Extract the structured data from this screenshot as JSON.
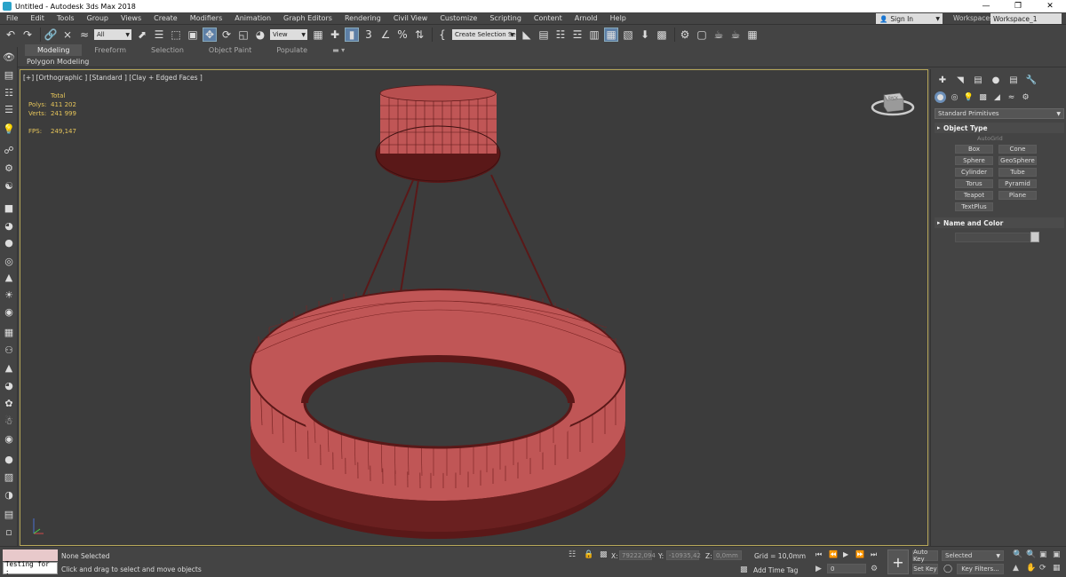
{
  "window": {
    "title": "Untitled - Autodesk 3ds Max 2018",
    "controls": [
      "—",
      "❐",
      "✕"
    ]
  },
  "menubar": {
    "items": [
      "File",
      "Edit",
      "Tools",
      "Group",
      "Views",
      "Create",
      "Modifiers",
      "Animation",
      "Graph Editors",
      "Rendering",
      "Civil View",
      "Customize",
      "Scripting",
      "Content",
      "Arnold",
      "Help"
    ],
    "signin_label": "Sign In",
    "workspaces_label": "Workspaces:",
    "workspace_value": "Workspace_1"
  },
  "toolbar": {
    "filter_value": "All",
    "refcoord_value": "View",
    "selection_set_value": "Create Selection Se"
  },
  "ribbon": {
    "tabs": [
      "Modeling",
      "Freeform",
      "Selection",
      "Object Paint",
      "Populate"
    ],
    "active_tab": "Modeling",
    "panel_label": "Polygon Modeling"
  },
  "viewport": {
    "label": "[+] [Orthographic ] [Standard ] [Clay + Edged Faces ]",
    "stats": {
      "total_label": "Total",
      "polys_label": "Polys:",
      "polys_value": "411 202",
      "verts_label": "Verts:",
      "verts_value": "241 999",
      "fps_label": "FPS:",
      "fps_value": "249,147"
    },
    "mesh_color": "#c05656",
    "mesh_dark": "#5a1818",
    "viewcube_label": "BACK"
  },
  "command_panel": {
    "category_dropdown": "Standard Primitives",
    "object_type_title": "Object Type",
    "autogrid_label": "AutoGrid",
    "buttons": [
      "Box",
      "Cone",
      "Sphere",
      "GeoSphere",
      "Cylinder",
      "Tube",
      "Torus",
      "Pyramid",
      "Teapot",
      "Plane",
      "TextPlus"
    ],
    "name_color_title": "Name and Color"
  },
  "statusbar": {
    "maxscript_text": "Testing for :",
    "selection_status": "None Selected",
    "prompt": "Click and drag to select and move objects",
    "x_label": "X:",
    "x_value": "79222,094",
    "y_label": "Y:",
    "y_value": "-10935,42",
    "z_label": "Z:",
    "z_value": "0,0mm",
    "grid_label": "Grid = 10,0mm",
    "add_time_tag": "Add Time Tag",
    "frame_value": "0",
    "auto_key": "Auto Key",
    "set_key": "Set Key",
    "selected_value": "Selected",
    "key_filters": "Key Filters..."
  }
}
